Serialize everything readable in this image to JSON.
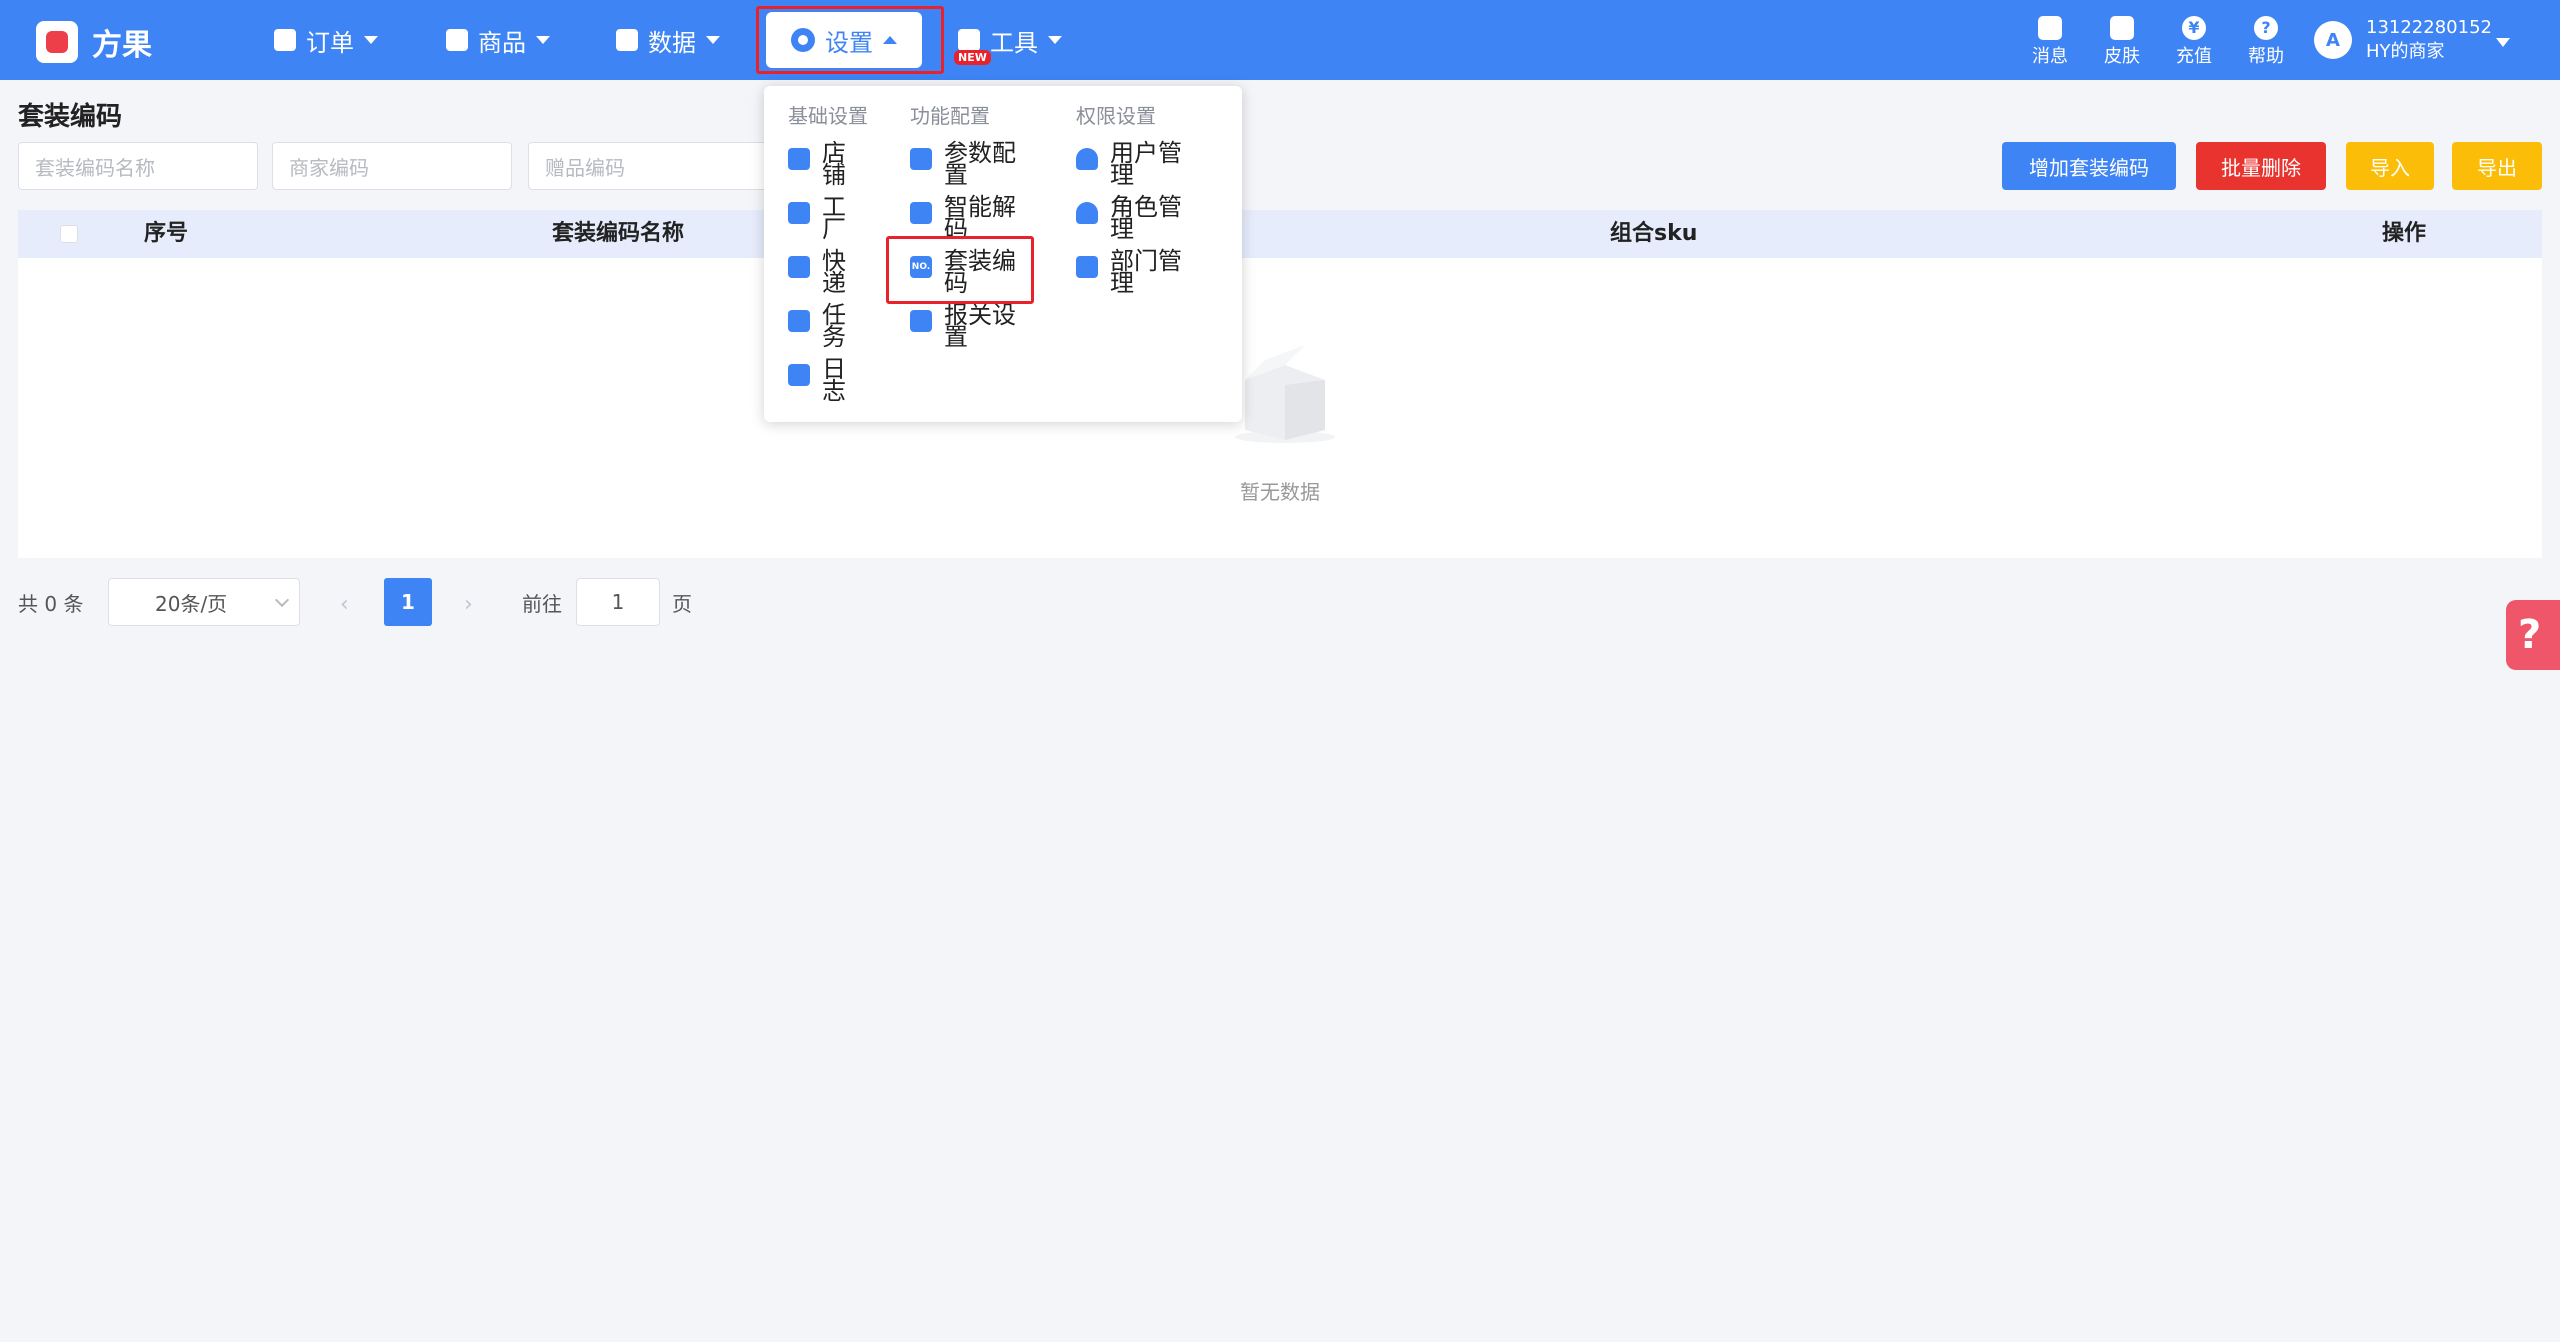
{
  "brand": {
    "name": "方果"
  },
  "nav": {
    "orders": "订单",
    "products": "商品",
    "data": "数据",
    "settings": "设置",
    "tools": "工具",
    "tools_badge": "NEW"
  },
  "utils": {
    "messages": "消息",
    "skin": "皮肤",
    "recharge": "充值",
    "recharge_icon": "¥",
    "help": "帮助",
    "help_icon": "?"
  },
  "user": {
    "phone": "13122280152",
    "shop": "HY的商家",
    "avatar_letter": "A"
  },
  "page": {
    "title": "套装编码"
  },
  "filters": {
    "combo_name_placeholder": "套装编码名称",
    "merchant_code_placeholder": "商家编码",
    "gift_code_placeholder": "赠品编码"
  },
  "actions": {
    "add": "增加套装编码",
    "batch_delete": "批量删除",
    "import": "导入",
    "export": "导出"
  },
  "table": {
    "columns": [
      "序号",
      "套装编码名称",
      "组合sku",
      "操作"
    ],
    "empty_text": "暂无数据"
  },
  "pagination": {
    "total": "共 0 条",
    "page_size": "20条/页",
    "current_page": "1",
    "goto_label": "前往",
    "goto_value": "1",
    "page_unit": "页",
    "prev": "‹",
    "next": "›"
  },
  "dropdown": {
    "headers": [
      "基础设置",
      "功能配置",
      "权限设置"
    ],
    "basic": [
      "店铺",
      "工厂",
      "快递",
      "任务",
      "日志"
    ],
    "feature": [
      "参数配置",
      "智能解码",
      "套装编码",
      "报关设置"
    ],
    "permission": [
      "用户管理",
      "角色管理",
      "部门管理"
    ],
    "no_icon_text": "NO."
  },
  "colors": {
    "primary": "#3e84f4",
    "danger": "#e8332f",
    "warning": "#fbbd08",
    "highlight_border": "#e8212b"
  }
}
